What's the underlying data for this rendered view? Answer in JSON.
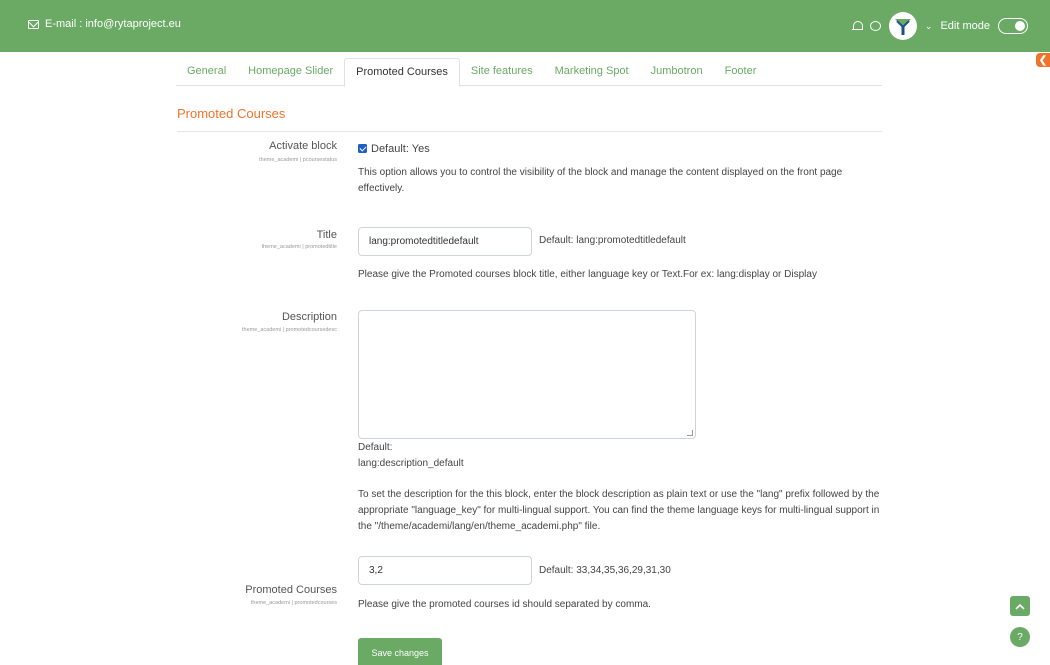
{
  "topbar": {
    "email": "E-mail : info@rytaproject.eu",
    "edit_mode_label": "Edit mode"
  },
  "tabs": [
    {
      "label": "General"
    },
    {
      "label": "Homepage Slider"
    },
    {
      "label": "Promoted Courses",
      "active": true
    },
    {
      "label": "Site features"
    },
    {
      "label": "Marketing Spot"
    },
    {
      "label": "Jumbotron"
    },
    {
      "label": "Footer"
    }
  ],
  "section_title": "Promoted Courses",
  "settings": {
    "activate": {
      "label": "Activate block",
      "sublabel": "theme_academi | pcoursestatus",
      "checkbox_label": "Default: Yes",
      "checked": true,
      "description": "This option allows you to control the visibility of the block and manage the content displayed on the front page effectively."
    },
    "title": {
      "label": "Title",
      "sublabel": "theme_academi | promotedtitle",
      "value": "lang:promotedtitledefault",
      "default": "Default: lang:promotedtitledefault",
      "description": "Please give the Promoted courses block title, either language key or Text.For ex: lang:display or Display"
    },
    "description": {
      "label": "Description",
      "sublabel": "theme_academi | promotedcoursedesc",
      "value": "",
      "default_label": "Default:",
      "default_value": "lang:description_default",
      "description": "To set the description for the this block, enter the block description as plain text or use the \"lang\" prefix followed by the appropriate \"language_key\" for multi-lingual support. You can find the theme language keys for multi-lingual support in the \"/theme/academi/lang/en/theme_academi.php\" file."
    },
    "promoted_courses": {
      "label": "Promoted Courses",
      "sublabel": "theme_academi | promotedcourses",
      "value": "3,2",
      "default": "Default: 33,34,35,36,29,31,30",
      "description": "Please give the promoted courses id should separated by comma."
    }
  },
  "save_label": "Save changes",
  "side_tab_glyph": "❮",
  "help_glyph": "?",
  "colors": {
    "brand_green": "#6aaa64",
    "accent_orange": "#f0732b",
    "checkbox_blue": "#1f5fc8"
  }
}
